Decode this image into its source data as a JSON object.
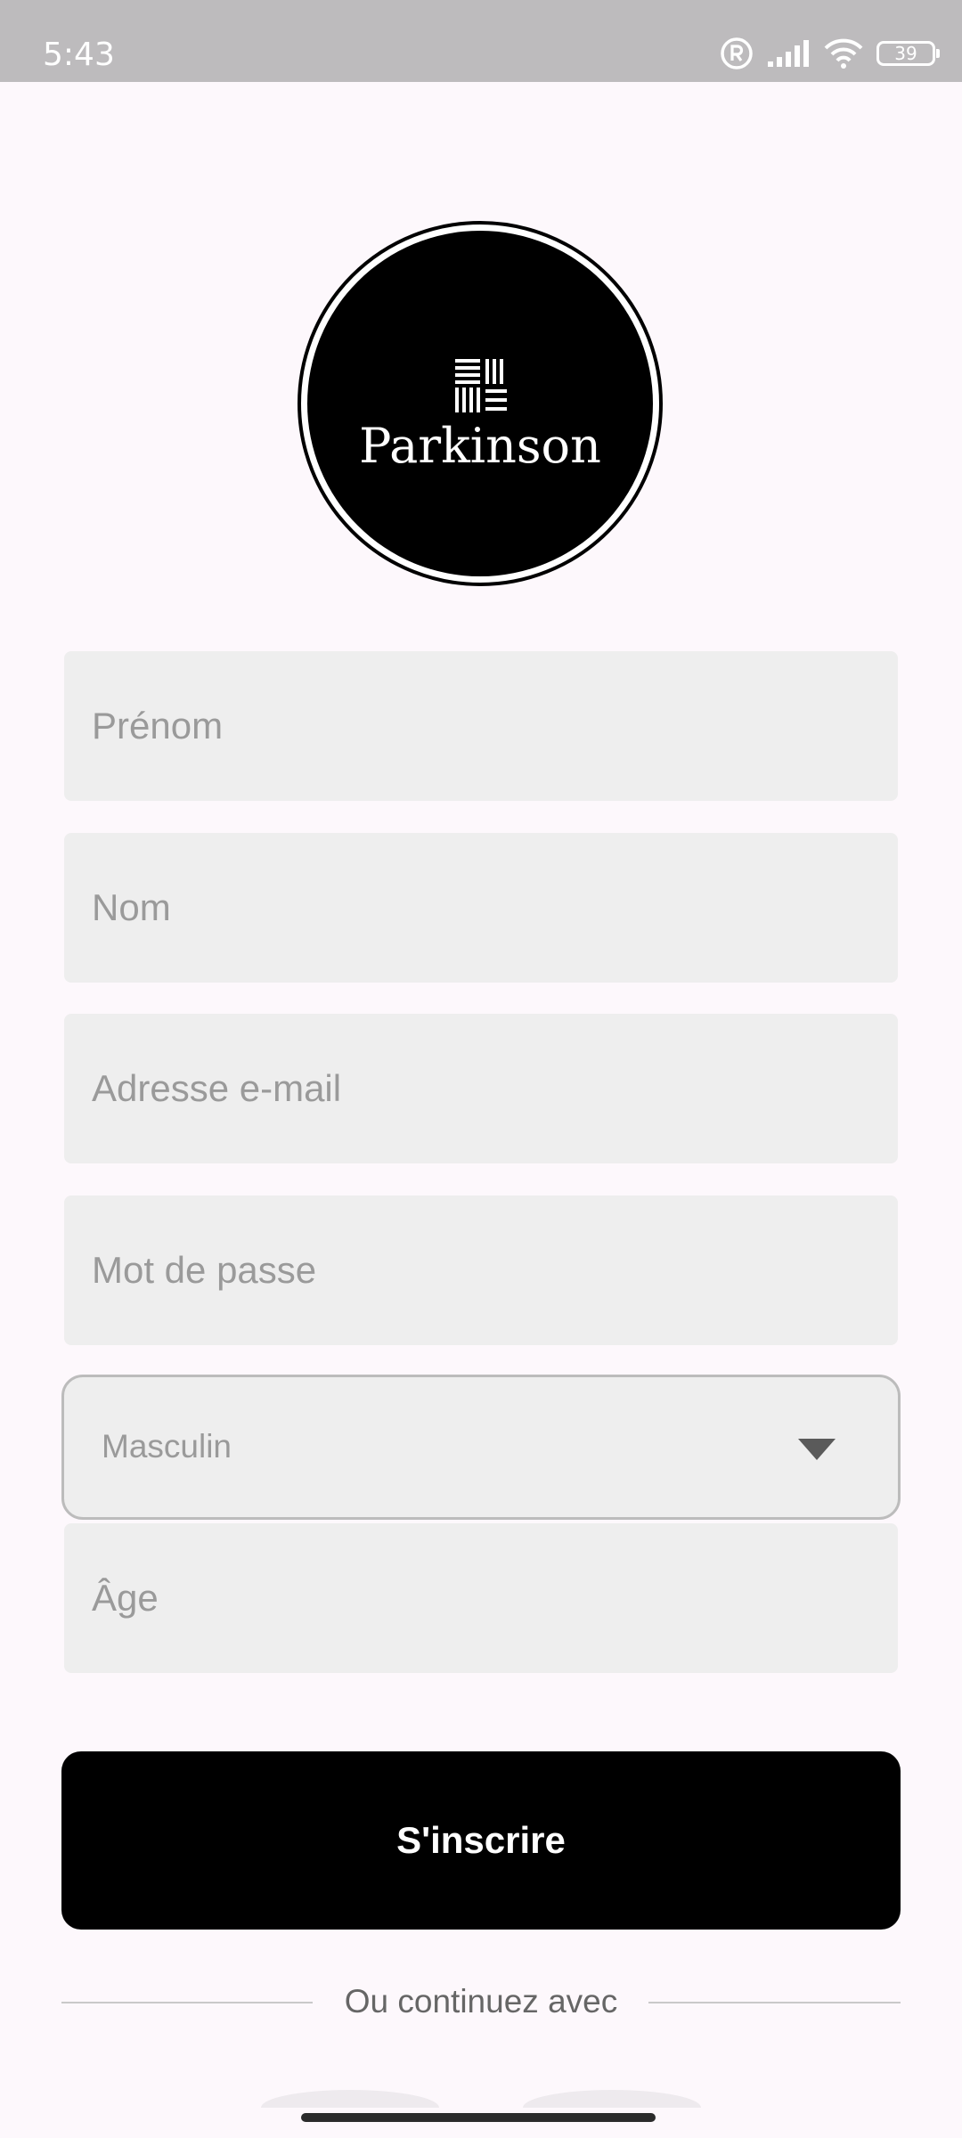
{
  "status_bar": {
    "time": "5:43",
    "battery": "39",
    "icons": [
      "registered-icon",
      "signal-icon",
      "wifi-icon",
      "battery-icon"
    ]
  },
  "logo": {
    "text": "Parkinson"
  },
  "form": {
    "first_name_placeholder": "Prénom",
    "last_name_placeholder": "Nom",
    "email_placeholder": "Adresse e-mail",
    "password_placeholder": "Mot de passe",
    "gender_value": "Masculin",
    "age_placeholder": "Âge"
  },
  "submit_label": "S'inscrire",
  "divider_text": "Ou continuez avec"
}
